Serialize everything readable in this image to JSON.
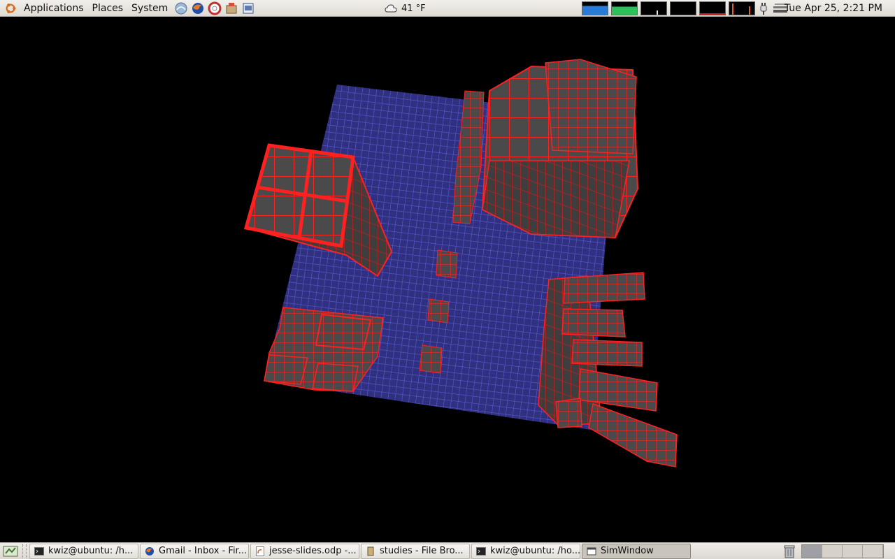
{
  "top_panel": {
    "menus": [
      "Applications",
      "Places",
      "System"
    ],
    "launchers": [
      "network-icon",
      "firefox-icon",
      "help-icon",
      "package-icon",
      "editor-icon"
    ],
    "weather": {
      "icon": "cloudy-icon",
      "text": "41 °F"
    },
    "clock": "Tue Apr 25,  2:21 PM",
    "monitor_colors": [
      "#2a7bd6",
      "#2ec05a",
      "#000000",
      "#000000",
      "#000000",
      "#000000"
    ]
  },
  "scene": {
    "background": "#000000",
    "floor_color": "#5a5ad0",
    "cube_face": "#4a4a4a",
    "cube_edge": "#ff2020"
  },
  "taskbar": {
    "tasks": [
      {
        "label": "kwiz@ubuntu: /h...",
        "icon": "terminal-icon"
      },
      {
        "label": "Gmail - Inbox - Fir...",
        "icon": "firefox-icon"
      },
      {
        "label": "jesse-slides.odp -...",
        "icon": "presentation-icon"
      },
      {
        "label": "studies - File Bro...",
        "icon": "folder-icon"
      },
      {
        "label": "kwiz@ubuntu: /ho...",
        "icon": "terminal-icon"
      },
      {
        "label": "SimWindow",
        "icon": "window-icon",
        "active": true
      }
    ],
    "workspaces": 4,
    "active_workspace": 0
  }
}
